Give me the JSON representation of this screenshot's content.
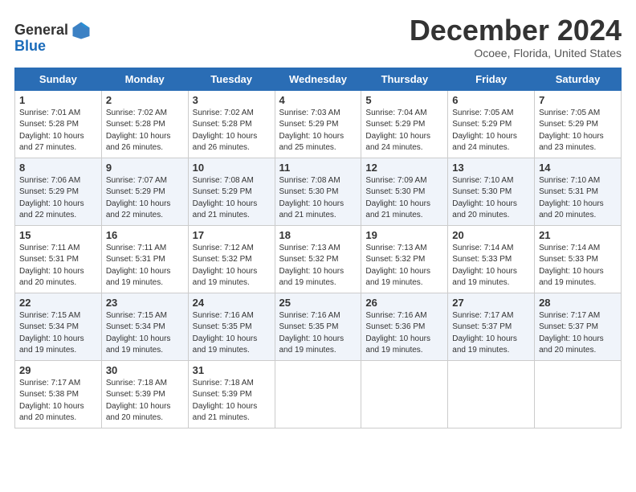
{
  "logo": {
    "text_general": "General",
    "text_blue": "Blue"
  },
  "title": "December 2024",
  "location": "Ocoee, Florida, United States",
  "days_header": [
    "Sunday",
    "Monday",
    "Tuesday",
    "Wednesday",
    "Thursday",
    "Friday",
    "Saturday"
  ],
  "weeks": [
    [
      {
        "day": "1",
        "info": "Sunrise: 7:01 AM\nSunset: 5:28 PM\nDaylight: 10 hours\nand 27 minutes."
      },
      {
        "day": "2",
        "info": "Sunrise: 7:02 AM\nSunset: 5:28 PM\nDaylight: 10 hours\nand 26 minutes."
      },
      {
        "day": "3",
        "info": "Sunrise: 7:02 AM\nSunset: 5:28 PM\nDaylight: 10 hours\nand 26 minutes."
      },
      {
        "day": "4",
        "info": "Sunrise: 7:03 AM\nSunset: 5:29 PM\nDaylight: 10 hours\nand 25 minutes."
      },
      {
        "day": "5",
        "info": "Sunrise: 7:04 AM\nSunset: 5:29 PM\nDaylight: 10 hours\nand 24 minutes."
      },
      {
        "day": "6",
        "info": "Sunrise: 7:05 AM\nSunset: 5:29 PM\nDaylight: 10 hours\nand 24 minutes."
      },
      {
        "day": "7",
        "info": "Sunrise: 7:05 AM\nSunset: 5:29 PM\nDaylight: 10 hours\nand 23 minutes."
      }
    ],
    [
      {
        "day": "8",
        "info": "Sunrise: 7:06 AM\nSunset: 5:29 PM\nDaylight: 10 hours\nand 22 minutes."
      },
      {
        "day": "9",
        "info": "Sunrise: 7:07 AM\nSunset: 5:29 PM\nDaylight: 10 hours\nand 22 minutes."
      },
      {
        "day": "10",
        "info": "Sunrise: 7:08 AM\nSunset: 5:29 PM\nDaylight: 10 hours\nand 21 minutes."
      },
      {
        "day": "11",
        "info": "Sunrise: 7:08 AM\nSunset: 5:30 PM\nDaylight: 10 hours\nand 21 minutes."
      },
      {
        "day": "12",
        "info": "Sunrise: 7:09 AM\nSunset: 5:30 PM\nDaylight: 10 hours\nand 21 minutes."
      },
      {
        "day": "13",
        "info": "Sunrise: 7:10 AM\nSunset: 5:30 PM\nDaylight: 10 hours\nand 20 minutes."
      },
      {
        "day": "14",
        "info": "Sunrise: 7:10 AM\nSunset: 5:31 PM\nDaylight: 10 hours\nand 20 minutes."
      }
    ],
    [
      {
        "day": "15",
        "info": "Sunrise: 7:11 AM\nSunset: 5:31 PM\nDaylight: 10 hours\nand 20 minutes."
      },
      {
        "day": "16",
        "info": "Sunrise: 7:11 AM\nSunset: 5:31 PM\nDaylight: 10 hours\nand 19 minutes."
      },
      {
        "day": "17",
        "info": "Sunrise: 7:12 AM\nSunset: 5:32 PM\nDaylight: 10 hours\nand 19 minutes."
      },
      {
        "day": "18",
        "info": "Sunrise: 7:13 AM\nSunset: 5:32 PM\nDaylight: 10 hours\nand 19 minutes."
      },
      {
        "day": "19",
        "info": "Sunrise: 7:13 AM\nSunset: 5:32 PM\nDaylight: 10 hours\nand 19 minutes."
      },
      {
        "day": "20",
        "info": "Sunrise: 7:14 AM\nSunset: 5:33 PM\nDaylight: 10 hours\nand 19 minutes."
      },
      {
        "day": "21",
        "info": "Sunrise: 7:14 AM\nSunset: 5:33 PM\nDaylight: 10 hours\nand 19 minutes."
      }
    ],
    [
      {
        "day": "22",
        "info": "Sunrise: 7:15 AM\nSunset: 5:34 PM\nDaylight: 10 hours\nand 19 minutes."
      },
      {
        "day": "23",
        "info": "Sunrise: 7:15 AM\nSunset: 5:34 PM\nDaylight: 10 hours\nand 19 minutes."
      },
      {
        "day": "24",
        "info": "Sunrise: 7:16 AM\nSunset: 5:35 PM\nDaylight: 10 hours\nand 19 minutes."
      },
      {
        "day": "25",
        "info": "Sunrise: 7:16 AM\nSunset: 5:35 PM\nDaylight: 10 hours\nand 19 minutes."
      },
      {
        "day": "26",
        "info": "Sunrise: 7:16 AM\nSunset: 5:36 PM\nDaylight: 10 hours\nand 19 minutes."
      },
      {
        "day": "27",
        "info": "Sunrise: 7:17 AM\nSunset: 5:37 PM\nDaylight: 10 hours\nand 19 minutes."
      },
      {
        "day": "28",
        "info": "Sunrise: 7:17 AM\nSunset: 5:37 PM\nDaylight: 10 hours\nand 20 minutes."
      }
    ],
    [
      {
        "day": "29",
        "info": "Sunrise: 7:17 AM\nSunset: 5:38 PM\nDaylight: 10 hours\nand 20 minutes."
      },
      {
        "day": "30",
        "info": "Sunrise: 7:18 AM\nSunset: 5:39 PM\nDaylight: 10 hours\nand 20 minutes."
      },
      {
        "day": "31",
        "info": "Sunrise: 7:18 AM\nSunset: 5:39 PM\nDaylight: 10 hours\nand 21 minutes."
      },
      null,
      null,
      null,
      null
    ]
  ]
}
